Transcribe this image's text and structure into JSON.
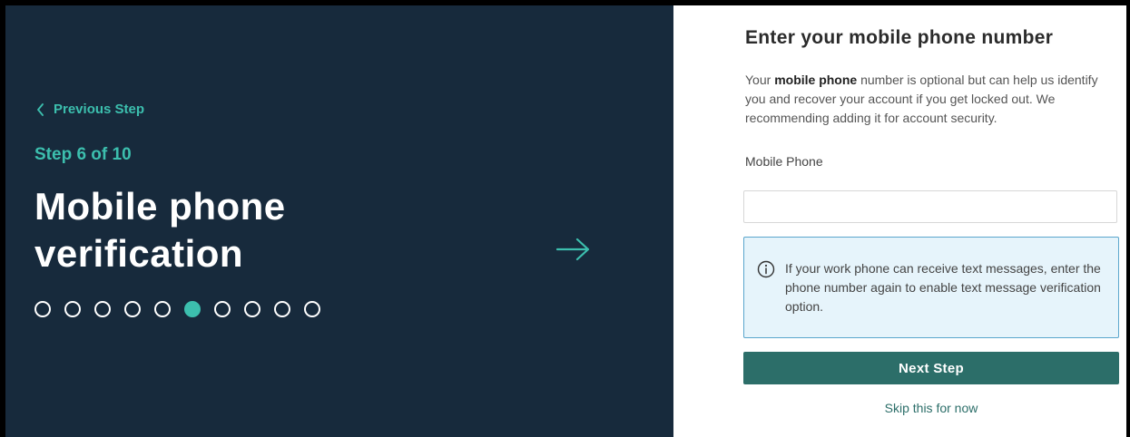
{
  "left_panel": {
    "previous_step": "Previous Step",
    "step_indicator": "Step 6 of 10",
    "title_line1": "Mobile phone",
    "title_line2": "verification",
    "progress": {
      "total_steps": 10,
      "current_step": 6
    },
    "next_arrow_icon": "arrow-right-icon"
  },
  "form": {
    "heading": "Enter your mobile phone number",
    "description_prefix": "Your ",
    "description_bold": "mobile phone",
    "description_suffix": " number is optional but can help us identify you and recover your account if you get locked out. We recommending adding it for account security.",
    "field_label": "Mobile Phone",
    "field_value": "",
    "info_icon": "info-circle-icon",
    "info_text": "If your work phone can receive text messages, enter the phone number again to enable text message verification option.",
    "next_button": "Next Step",
    "skip_link": "Skip this for now"
  },
  "colors": {
    "left_bg": "#172a3c",
    "accent": "#3cbfae",
    "button": "#2c6e69",
    "info_bg": "#e6f4fb",
    "info_border": "#5aa6cd"
  }
}
